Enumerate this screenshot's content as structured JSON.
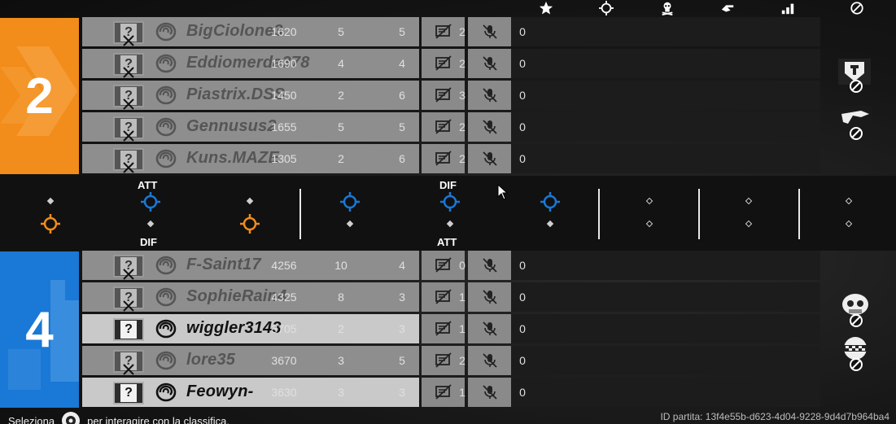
{
  "header": {
    "columns": [
      {
        "icon": "star-icon",
        "label": "score"
      },
      {
        "icon": "crosshair-icon",
        "label": "kills"
      },
      {
        "icon": "skull-icon",
        "label": "deaths"
      },
      {
        "icon": "assist-icon",
        "label": "assists"
      },
      {
        "icon": "ping-icon",
        "label": "ping"
      },
      {
        "icon": "ban-icon",
        "label": "bans"
      }
    ]
  },
  "team_orange": {
    "score": "2",
    "color": "#f28c1a",
    "players": [
      {
        "name": "BigCiolone3",
        "score": "1620",
        "kills": "5",
        "deaths": "5",
        "assists": "2",
        "ping": "0"
      },
      {
        "name": "Eddiomerda378",
        "score": "1690",
        "kills": "4",
        "deaths": "4",
        "assists": "2",
        "ping": "0"
      },
      {
        "name": "Piastrix.DSS",
        "score": "1450",
        "kills": "2",
        "deaths": "6",
        "assists": "3",
        "ping": "0"
      },
      {
        "name": "Gennusus2",
        "score": "1655",
        "kills": "5",
        "deaths": "5",
        "assists": "2",
        "ping": "0"
      },
      {
        "name": "Kuns.MAZE",
        "score": "1305",
        "kills": "2",
        "deaths": "6",
        "assists": "2",
        "ping": "0"
      }
    ]
  },
  "team_blue": {
    "score": "4",
    "color": "#1a78d6",
    "players": [
      {
        "name": "F-Saint17",
        "score": "4256",
        "kills": "10",
        "deaths": "4",
        "assists": "0",
        "ping": "0"
      },
      {
        "name": "SophieRain4",
        "score": "4325",
        "kills": "8",
        "deaths": "3",
        "assists": "1",
        "ping": "0"
      },
      {
        "name": "wiggler3143",
        "score": "3705",
        "kills": "2",
        "deaths": "3",
        "assists": "1",
        "ping": "0"
      },
      {
        "name": "lore35",
        "score": "3670",
        "kills": "3",
        "deaths": "5",
        "assists": "2",
        "ping": "0"
      },
      {
        "name": "Feowyn-",
        "score": "3630",
        "kills": "3",
        "deaths": "3",
        "assists": "1",
        "ping": "0"
      }
    ]
  },
  "rounds": {
    "top_label_att": "ATT",
    "top_label_dif": "DIF",
    "bottom_label_dif": "DIF",
    "bottom_label_att": "ATT"
  },
  "footer": {
    "select_text": "Seleziona",
    "interact_text": "per interagire con la classifica.",
    "match_id": "ID partita: 13f4e55b-d623-4d04-9228-9d4d7b964ba4"
  },
  "colors": {
    "orange": "#f28c1a",
    "blue": "#1a78d6"
  }
}
